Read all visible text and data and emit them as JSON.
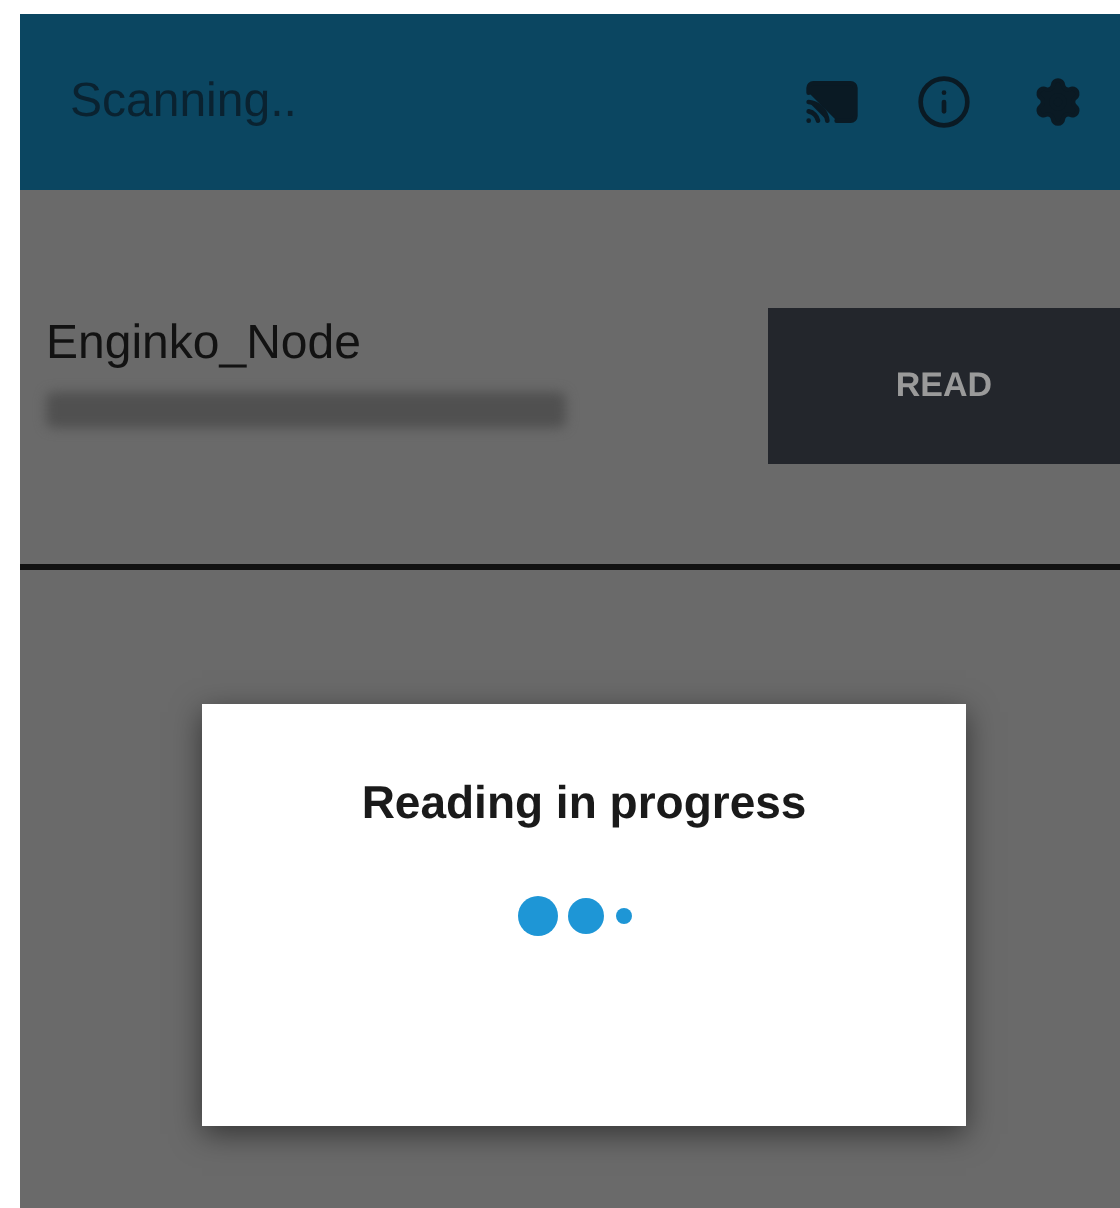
{
  "app_bar": {
    "title": "Scanning.."
  },
  "devices": [
    {
      "name": "Enginko_Node",
      "button": "READ"
    }
  ],
  "dialog": {
    "title": "Reading in progress"
  }
}
